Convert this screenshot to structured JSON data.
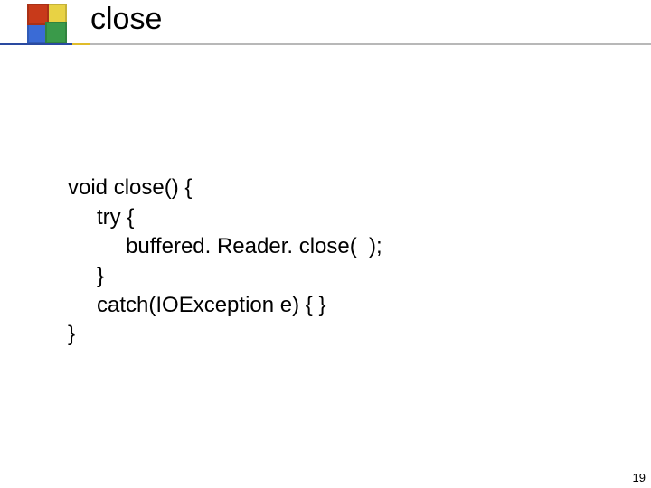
{
  "title": "close",
  "code": {
    "l1": "void close() {",
    "l2": "try {",
    "l3": "buffered. Reader. close(  );",
    "l4": "}",
    "l5": "catch(IOException e) { }",
    "l6": "}"
  },
  "page_number": "19"
}
